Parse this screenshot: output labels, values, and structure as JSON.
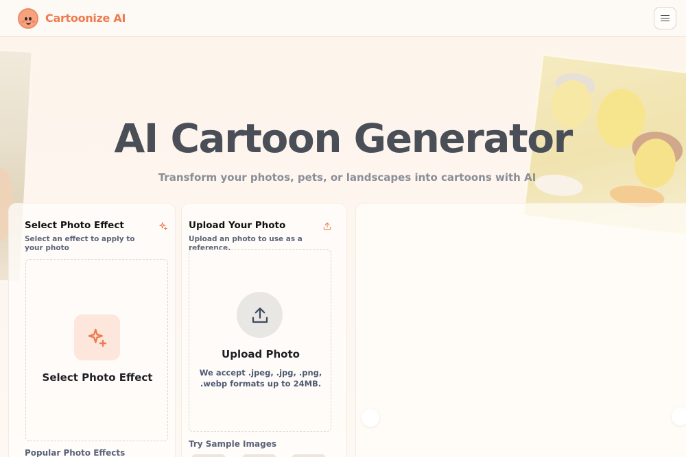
{
  "header": {
    "brand": "Cartoonize AI",
    "logo_icon": "smiling-face-logo",
    "menu_icon": "hamburger-icon",
    "accent_color": "#f07a4d"
  },
  "hero": {
    "title": "AI Cartoon Generator",
    "subtitle": "Transform your photos, pets, or landscapes into cartoons with AI"
  },
  "effect_panel": {
    "title": "Select Photo Effect",
    "description": "Select an effect to apply to your photo",
    "corner_icon": "sparkles-icon",
    "dropzone_icon": "sparkles-icon",
    "dropzone_label": "Select Photo Effect",
    "popular_label": "Popular Photo Effects"
  },
  "upload_panel": {
    "title": "Upload Your Photo",
    "description": "Upload an photo to use as a reference.",
    "corner_icon": "upload-icon",
    "dropzone_icon": "upload-icon",
    "dropzone_label": "Upload Photo",
    "hint": "We accept .jpeg, .jpg, .png, .webp formats up to 24MB.",
    "samples_label": "Try Sample Images"
  },
  "output_panel": {
    "prev_icon": "chevron-left-icon",
    "next_icon": "chevron-right-icon"
  }
}
